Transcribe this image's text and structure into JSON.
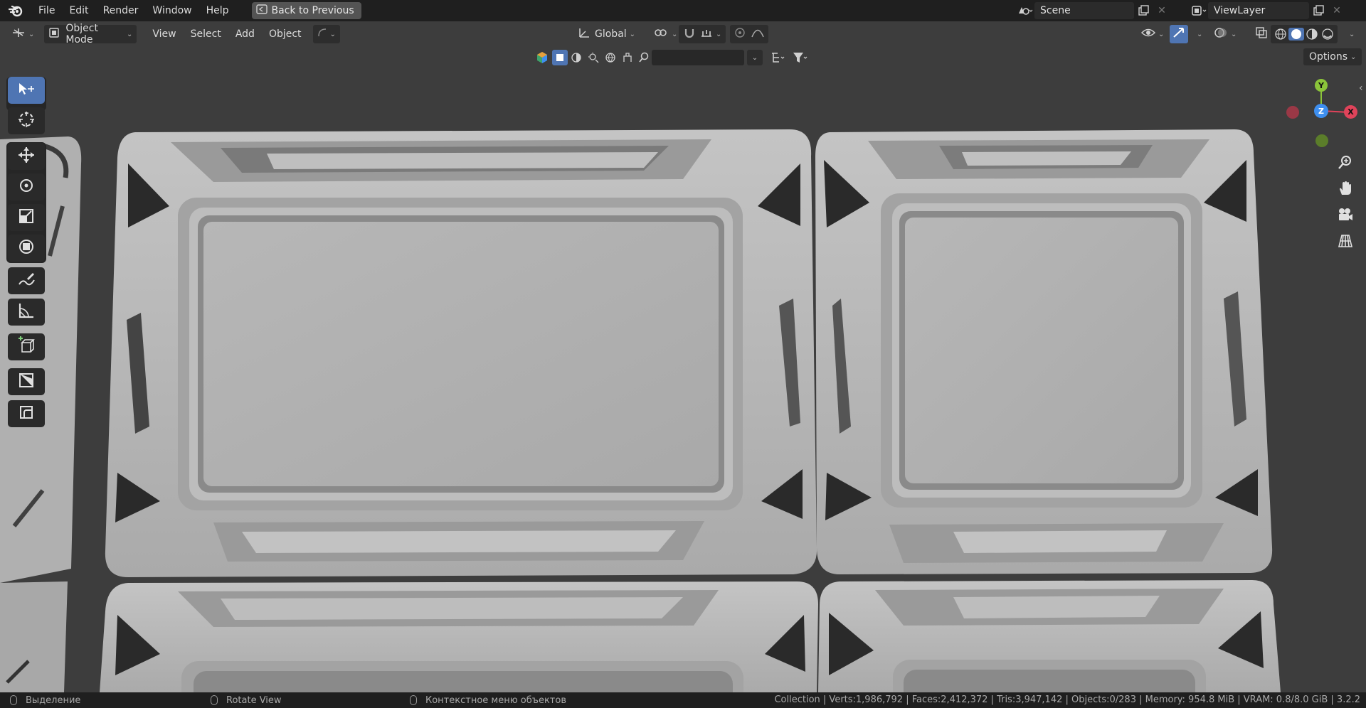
{
  "menu": {
    "items": [
      "File",
      "Edit",
      "Render",
      "Window",
      "Help"
    ],
    "back_label": "Back to Previous"
  },
  "scene": {
    "label": "Scene"
  },
  "view_layer": {
    "label": "ViewLayer"
  },
  "viewport_header": {
    "mode": "Object Mode",
    "menus": [
      "View",
      "Select",
      "Add",
      "Object"
    ],
    "orientation": "Global",
    "options_label": "Options"
  },
  "gizmo": {
    "y": "Y",
    "z": "Z",
    "x": "X"
  },
  "toolbar": {
    "tools": [
      "select-box",
      "cursor",
      "move",
      "rotate",
      "scale",
      "transform",
      "annotate",
      "measure",
      "add-cube",
      "tool-extra-1",
      "tool-extra-2"
    ]
  },
  "status": {
    "hint1": "Выделение",
    "hint2": "Rotate View",
    "hint3": "Контекстное меню объектов",
    "stats": "Collection | Verts:1,986,792 | Faces:2,412,372 | Tris:3,947,142 | Objects:0/283 | Memory: 954.8 MiB | VRAM: 0.8/8.0 GiB | 3.2.2"
  },
  "colors": {
    "accent": "#4f75b3",
    "viewport_bg": "#3d3d3d",
    "model": "#b3b3b3",
    "axis_x": "#e0435a",
    "axis_y": "#8bc43a",
    "axis_z": "#3e8ff0"
  }
}
